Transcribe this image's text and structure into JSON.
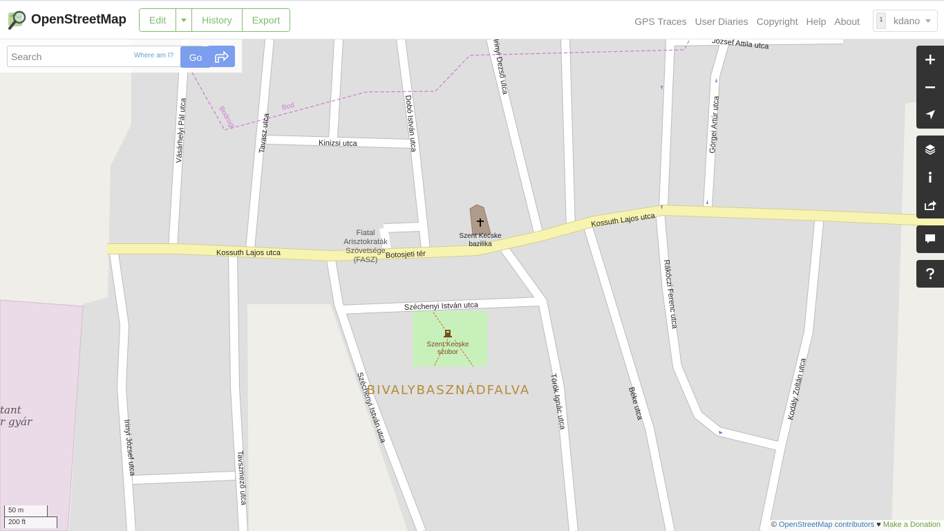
{
  "header": {
    "logo_text": "OpenStreetMap",
    "nav": {
      "edit": "Edit",
      "history": "History",
      "export": "Export"
    },
    "links": [
      "GPS Traces",
      "User Diaries",
      "Copyright",
      "Help",
      "About"
    ],
    "user": {
      "name": "kdano",
      "badge": "1"
    }
  },
  "search": {
    "placeholder": "Search",
    "where_am_i": "Where am I?",
    "go": "Go"
  },
  "map": {
    "streets": {
      "kossuth_west": "Kossuth Lajos utca",
      "kossuth_east": "Kossuth Lajos utca",
      "botosjeti": "Botosjeti tér",
      "kinizsi": "Kinizsi utca",
      "vasarhelyi": "Vásárhelyi Pál utca",
      "tavasz": "Tavasz utca",
      "dobo": "Dobó István utca",
      "szechenyi_street": "Széchenyi István utca",
      "szechenyi_diag": "Széchenyi István utca",
      "torok": "Török Ignác utca",
      "beke": "Béke utca",
      "rakoczi": "Rákóczi Ferenc utca",
      "kodaly": "Kodály Zoltán utca",
      "gorgei": "Görgei Artúr utca",
      "jozsef_attila": "József Attila utca",
      "irinyi_dezso": "Irinyi Dezső utca",
      "irinyi_jozsef": "Irinyi József utca",
      "tavszmezo": "Tavszmező utca",
      "bodrog": "Bodrogi",
      "bodrog2": "Bod"
    },
    "pois": {
      "basilica": [
        "Szent Kecske",
        "bazilika"
      ],
      "statue": [
        "Szent Kecske",
        "szobor"
      ],
      "org": [
        "Fiatal",
        "Arisztokraták",
        "Szövetsége",
        "(FASZ)"
      ],
      "factory": [
        "tant",
        "r gyár"
      ]
    },
    "place_name": "BIVALYBASZNÁDFALVA"
  },
  "scale": {
    "metric": "50 m",
    "imperial": "200 ft"
  },
  "attribution": {
    "copy": "©",
    "contributors": "OpenStreetMap contributors",
    "heart": "♥",
    "donate": "Make a Donation"
  },
  "colors": {
    "brand_green": "#7ebc6f",
    "search_blue": "#7b9fee",
    "primary_road": "#f7f4b2",
    "land": "#e0dfdf",
    "park": "#c8f0bb"
  }
}
